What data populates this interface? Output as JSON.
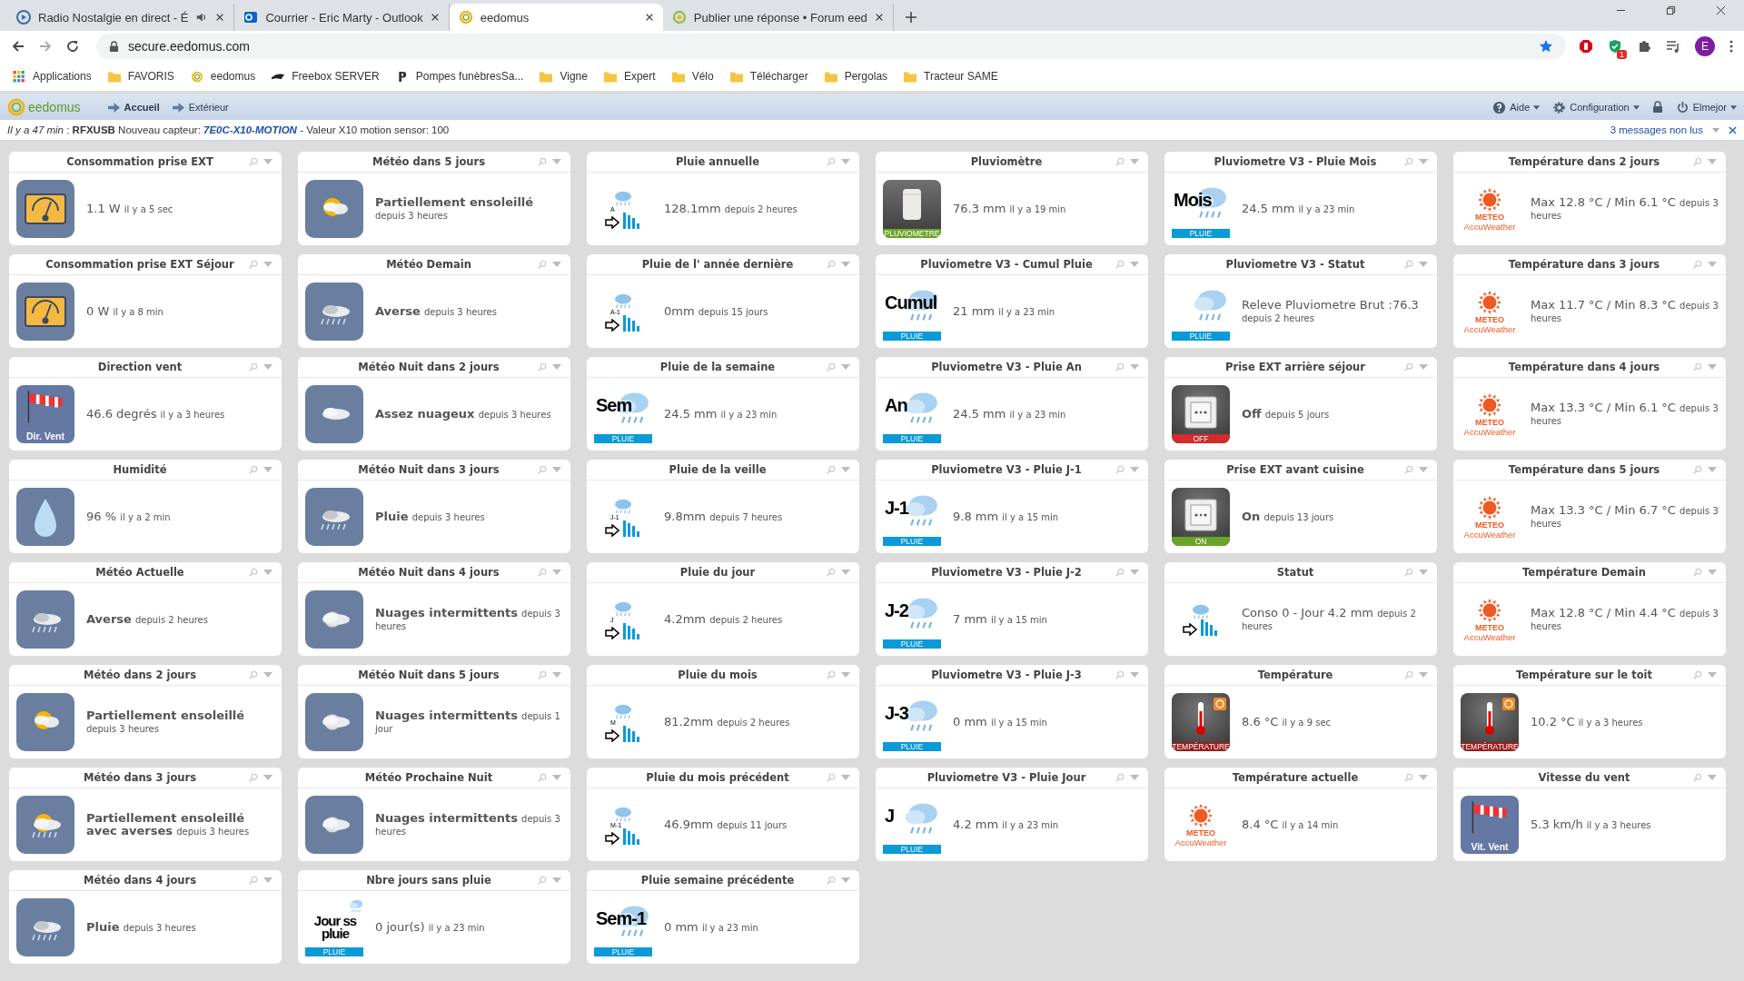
{
  "browser": {
    "tabs": [
      {
        "title": "Radio Nostalgie en direct - É",
        "kind": "radio",
        "audio": true,
        "selected": false
      },
      {
        "title": "Courrier - Eric Marty - Outlook",
        "kind": "outlook",
        "audio": false,
        "selected": false
      },
      {
        "title": "eedomus",
        "kind": "eedomus",
        "audio": false,
        "selected": true
      },
      {
        "title": "Publier une réponse • Forum eed",
        "kind": "forum",
        "audio": false,
        "selected": false
      }
    ],
    "url": "secure.eedomus.com",
    "extension_badge": "1",
    "avatar": "E",
    "bookmarks": [
      {
        "label": "Applications",
        "kind": "apps"
      },
      {
        "label": "FAVORIS",
        "kind": "folder"
      },
      {
        "label": "eedomus",
        "kind": "eedomus"
      },
      {
        "label": "Freebox SERVER",
        "kind": "freebox"
      },
      {
        "label": "Pompes funèbresSa...",
        "kind": "letter"
      },
      {
        "label": "Vigne",
        "kind": "folder"
      },
      {
        "label": "Expert",
        "kind": "folder"
      },
      {
        "label": "Vélo",
        "kind": "folder"
      },
      {
        "label": "Télécharger",
        "kind": "folder"
      },
      {
        "label": "Pergolas",
        "kind": "folder"
      },
      {
        "label": "Tracteur SAME",
        "kind": "folder"
      }
    ]
  },
  "app": {
    "logo": "eedomus",
    "nav": [
      {
        "label": "Accueil",
        "selected": true
      },
      {
        "label": "Extérieur",
        "selected": false
      }
    ],
    "menu": [
      {
        "label": "Aide",
        "kind": "help"
      },
      {
        "label": "Configuration",
        "kind": "gear"
      },
      {
        "kind": "lock"
      },
      {
        "label": "Elmejor",
        "kind": "power"
      }
    ]
  },
  "notification": {
    "text": "*Il y a 47 min* : **RFXUSB** Nouveau capteur: **7E0C-X10-MOTION** - Valeur X10 motion sensor: 100",
    "unread": "3 messages non lus"
  },
  "columns": [
    {
      "cards": [
        {
          "title": "Consommation prise EXT",
          "icon": {
            "kind": "gauge"
          },
          "value": "1.1 W",
          "value_bold": false,
          "since": "il y a 5 sec"
        },
        {
          "title": "Consommation prise EXT Séjour",
          "icon": {
            "kind": "gauge"
          },
          "value": "0 W",
          "value_bold": false,
          "since": "il y a 8 min"
        },
        {
          "title": "Direction vent",
          "icon": {
            "kind": "windsock",
            "label": "Dir. Vent"
          },
          "value": "46.6 degrés",
          "value_bold": false,
          "since": "il y a 3 heures"
        },
        {
          "title": "Humidité",
          "icon": {
            "kind": "drop"
          },
          "value": "96 %",
          "value_bold": false,
          "since": "il y a 2 min"
        },
        {
          "title": "Météo Actuelle",
          "icon": {
            "kind": "weather-rain"
          },
          "value": "Averse",
          "value_bold": true,
          "since": "depuis 2 heures"
        },
        {
          "title": "Météo dans 2 jours",
          "icon": {
            "kind": "weather-sun"
          },
          "value": "Partiellement ensoleillé",
          "value_bold": true,
          "since": "depuis 3 heures"
        },
        {
          "title": "Météo dans 3 jours",
          "icon": {
            "kind": "weather-sun-rain"
          },
          "value": "Partiellement ensoleillé avec averses",
          "value_bold": true,
          "since": "depuis 3 heures"
        },
        {
          "title": "Météo dans 4 jours",
          "icon": {
            "kind": "weather-rain"
          },
          "value": "Pluie",
          "value_bold": true,
          "since": "depuis 3 heures"
        }
      ]
    },
    {
      "cards": [
        {
          "title": "Météo dans 5 jours",
          "icon": {
            "kind": "weather-sun"
          },
          "value": "Partiellement ensoleillé",
          "value_bold": true,
          "since": "depuis 3 heures"
        },
        {
          "title": "Météo Demain",
          "icon": {
            "kind": "weather-rain"
          },
          "value": "Averse",
          "value_bold": true,
          "since": "depuis 3 heures"
        },
        {
          "title": "Météo Nuit dans 2 jours",
          "icon": {
            "kind": "weather-cloud"
          },
          "value": "Assez nuageux",
          "value_bold": true,
          "since": "depuis 3 heures"
        },
        {
          "title": "Météo Nuit dans 3 jours",
          "icon": {
            "kind": "weather-rain"
          },
          "value": "Pluie",
          "value_bold": true,
          "since": "depuis 3 heures"
        },
        {
          "title": "Météo Nuit dans 4 jours",
          "icon": {
            "kind": "weather-night"
          },
          "value": "Nuages intermittents",
          "value_bold": true,
          "since": "depuis 3 heures"
        },
        {
          "title": "Météo Nuit dans 5 jours",
          "icon": {
            "kind": "weather-night"
          },
          "value": "Nuages intermittents",
          "value_bold": true,
          "since": "depuis 1 jour"
        },
        {
          "title": "Météo Prochaine Nuit",
          "icon": {
            "kind": "weather-night"
          },
          "value": "Nuages intermittents",
          "value_bold": true,
          "since": "depuis 3 heures"
        },
        {
          "title": "Nbre jours sans pluie",
          "icon": {
            "kind": "rain-tile",
            "label": "Jour ss pluie",
            "banner": "PLUIE"
          },
          "value": "0 jour(s)",
          "value_bold": false,
          "since": "il y a 23 min"
        }
      ]
    },
    {
      "cards": [
        {
          "title": "Pluie annuelle",
          "icon": {
            "kind": "rain-chart",
            "label": "A"
          },
          "value": "128.1mm",
          "value_bold": false,
          "since": "depuis 2 heures"
        },
        {
          "title": "Pluie de l' année dernière",
          "icon": {
            "kind": "rain-chart",
            "label": "A-1"
          },
          "value": "0mm",
          "value_bold": false,
          "since": "depuis 15 jours"
        },
        {
          "title": "Pluie de la semaine",
          "icon": {
            "kind": "rain-tile",
            "label": "Sem",
            "banner": "PLUIE"
          },
          "value": "24.5 mm",
          "value_bold": false,
          "since": "il y a 23 min"
        },
        {
          "title": "Pluie de la veille",
          "icon": {
            "kind": "rain-chart",
            "label": "J-1"
          },
          "value": "9.8mm",
          "value_bold": false,
          "since": "depuis 7 heures"
        },
        {
          "title": "Pluie du jour",
          "icon": {
            "kind": "rain-chart",
            "label": "J"
          },
          "value": "4.2mm",
          "value_bold": false,
          "since": "depuis 2 heures"
        },
        {
          "title": "Pluie du mois",
          "icon": {
            "kind": "rain-chart",
            "label": "M"
          },
          "value": "81.2mm",
          "value_bold": false,
          "since": "depuis 2 heures"
        },
        {
          "title": "Pluie du mois précédent",
          "icon": {
            "kind": "rain-chart",
            "label": "M-1"
          },
          "value": "46.9mm",
          "value_bold": false,
          "since": "depuis 11 jours"
        },
        {
          "title": "Pluie semaine précédente",
          "icon": {
            "kind": "rain-tile",
            "label": "Sem-1",
            "banner": "PLUIE"
          },
          "value": "0 mm",
          "value_bold": false,
          "since": "il y a 23 min"
        }
      ]
    },
    {
      "cards": [
        {
          "title": "Pluviomètre",
          "icon": {
            "kind": "rain-gauge",
            "banner": "PLUVIOMETRE"
          },
          "value": "76.3 mm",
          "value_bold": false,
          "since": "il y a 19 min"
        },
        {
          "title": "Pluviometre V3 - Cumul Pluie",
          "icon": {
            "kind": "rain-tile",
            "label": "Cumul",
            "banner": "PLUIE"
          },
          "value": "21 mm",
          "value_bold": false,
          "since": "il y a 23 min"
        },
        {
          "title": "Pluviometre V3 - Pluie An",
          "icon": {
            "kind": "rain-tile",
            "label": "An",
            "banner": "PLUIE"
          },
          "value": "24.5 mm",
          "value_bold": false,
          "since": "il y a 23 min"
        },
        {
          "title": "Pluviometre V3 - Pluie J-1",
          "icon": {
            "kind": "rain-tile",
            "label": "J-1",
            "banner": "PLUIE"
          },
          "value": "9.8 mm",
          "value_bold": false,
          "since": "il y a 15 min"
        },
        {
          "title": "Pluviometre V3 - Pluie J-2",
          "icon": {
            "kind": "rain-tile",
            "label": "J-2",
            "banner": "PLUIE"
          },
          "value": "7 mm",
          "value_bold": false,
          "since": "il y a 15 min"
        },
        {
          "title": "Pluviometre V3 - Pluie J-3",
          "icon": {
            "kind": "rain-tile",
            "label": "J-3",
            "banner": "PLUIE"
          },
          "value": "0 mm",
          "value_bold": false,
          "since": "il y a 15 min"
        },
        {
          "title": "Pluviometre V3 - Pluie Jour",
          "icon": {
            "kind": "rain-tile",
            "label": "J",
            "banner": "PLUIE"
          },
          "value": "4.2 mm",
          "value_bold": false,
          "since": "il y a 23 min"
        }
      ]
    },
    {
      "cards": [
        {
          "title": "Pluviometre V3 - Pluie Mois",
          "icon": {
            "kind": "rain-tile",
            "label": "Mois",
            "banner": "PLUIE"
          },
          "value": "24.5 mm",
          "value_bold": false,
          "since": "il y a 23 min"
        },
        {
          "title": "Pluviometre V3 - Statut",
          "icon": {
            "kind": "rain-tile",
            "banner": "PLUIE"
          },
          "value": "Releve Pluviometre Brut :76.3",
          "value_bold": false,
          "since": "depuis 2 heures"
        },
        {
          "title": "Prise EXT arrière séjour",
          "icon": {
            "kind": "socket",
            "banner": "OFF",
            "on": false
          },
          "value": "Off",
          "value_bold": true,
          "since": "depuis 5 jours"
        },
        {
          "title": "Prise EXT avant cuisine",
          "icon": {
            "kind": "socket",
            "banner": "ON",
            "on": true
          },
          "value": "On",
          "value_bold": true,
          "since": "depuis 13 jours"
        },
        {
          "title": "Statut",
          "icon": {
            "kind": "rain-chart"
          },
          "value": "Conso 0 - Jour 4.2 mm",
          "value_bold": false,
          "since": "depuis 2 heures"
        },
        {
          "title": "Température",
          "icon": {
            "kind": "thermometer",
            "banner": "TEMPÉRATURE"
          },
          "value": "8.6 °C",
          "value_bold": false,
          "since": "il y a 9 sec"
        },
        {
          "title": "Température actuelle",
          "icon": {
            "kind": "accuweather",
            "label": "METEO",
            "sub": "AccuWeather"
          },
          "value": "8.4 °C",
          "value_bold": false,
          "since": "il y a 14 min"
        }
      ]
    },
    {
      "cards": [
        {
          "title": "Température dans 2 jours",
          "icon": {
            "kind": "accuweather",
            "label": "METEO",
            "sub": "AccuWeather"
          },
          "value": "Max 12.8 °C / Min 6.1 °C",
          "value_bold": false,
          "since": "depuis 3 heures"
        },
        {
          "title": "Température dans 3 jours",
          "icon": {
            "kind": "accuweather",
            "label": "METEO",
            "sub": "AccuWeather"
          },
          "value": "Max 11.7 °C / Min 8.3 °C",
          "value_bold": false,
          "since": "depuis 3 heures"
        },
        {
          "title": "Température dans 4 jours",
          "icon": {
            "kind": "accuweather",
            "label": "METEO",
            "sub": "AccuWeather"
          },
          "value": "Max 13.3 °C / Min 6.1 °C",
          "value_bold": false,
          "since": "depuis 3 heures"
        },
        {
          "title": "Température dans 5 jours",
          "icon": {
            "kind": "accuweather",
            "label": "METEO",
            "sub": "AccuWeather"
          },
          "value": "Max 13.3 °C / Min 6.7 °C",
          "value_bold": false,
          "since": "depuis 3 heures"
        },
        {
          "title": "Température Demain",
          "icon": {
            "kind": "accuweather",
            "label": "METEO",
            "sub": "AccuWeather"
          },
          "value": "Max 12.8 °C / Min 4.4 °C",
          "value_bold": false,
          "since": "depuis 3 heures"
        },
        {
          "title": "Température sur le toit",
          "icon": {
            "kind": "thermometer",
            "banner": "TEMPÉRATURE"
          },
          "value": "10.2 °C",
          "value_bold": false,
          "since": "il y a 3 heures"
        },
        {
          "title": "Vitesse du vent",
          "icon": {
            "kind": "windsock",
            "label": "Vit. Vent"
          },
          "value": "5.3 km/h",
          "value_bold": false,
          "since": "il y a 3 heures"
        }
      ]
    }
  ]
}
